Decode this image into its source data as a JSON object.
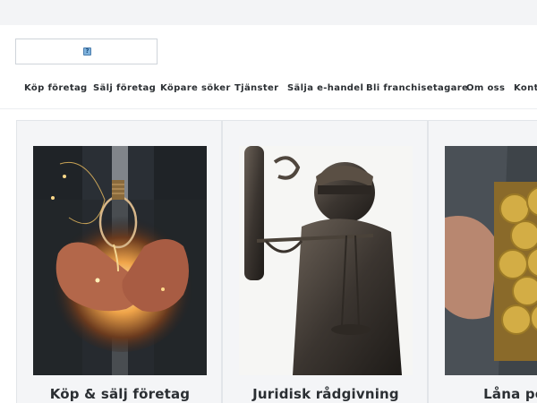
{
  "nav": {
    "items": [
      {
        "label": "Köp företag"
      },
      {
        "label": "Sälj företag"
      },
      {
        "label": "Köpare söker"
      },
      {
        "label": "Tjänster"
      },
      {
        "label": "Sälja e-handel"
      },
      {
        "label": "Bli franchisetagare"
      },
      {
        "label": "Om oss"
      },
      {
        "label": "Kontakt"
      }
    ]
  },
  "logo": {
    "icon": "broken-image-icon",
    "glyph": "?"
  },
  "cards": [
    {
      "title": "Köp & sälj företag",
      "image": "lightbulb-in-hands-photo"
    },
    {
      "title": "Juridisk rådgivning",
      "image": "lady-justice-statue-photo"
    },
    {
      "title": "Låna pengar",
      "image": "gold-coins-in-jacket-photo"
    }
  ],
  "colors": {
    "topbar": "#f3f4f6",
    "text": "#2b2f33",
    "card_bg": "#f4f5f7",
    "card_border": "#e2e5e9"
  }
}
